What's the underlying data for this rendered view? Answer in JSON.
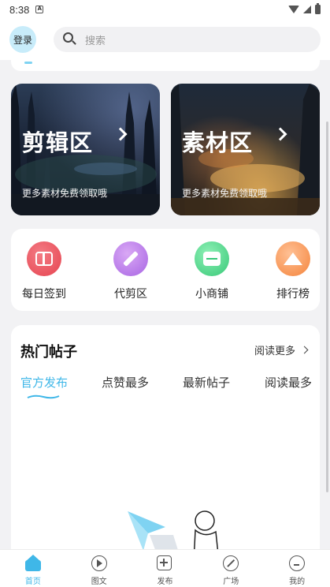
{
  "status_bar": {
    "time": "8:38",
    "notification_icon": "A"
  },
  "header": {
    "login_label": "登录",
    "search_placeholder": "搜索"
  },
  "banners": [
    {
      "title": "剪辑区",
      "subtitle": "更多素材免费领取哦"
    },
    {
      "title": "素材区",
      "subtitle": "更多素材免费领取哦"
    }
  ],
  "quick_actions": [
    {
      "label": "每日签到",
      "icon": "gift-box-icon",
      "color": "#e6434f"
    },
    {
      "label": "代剪区",
      "icon": "pencil-ruler-icon",
      "color": "#a865e3"
    },
    {
      "label": "小商铺",
      "icon": "shop-icon",
      "color": "#37c877"
    },
    {
      "label": "排行榜",
      "icon": "crown-icon",
      "color": "#f4843c"
    }
  ],
  "hot_posts": {
    "title": "热门帖子",
    "read_more": "阅读更多",
    "tabs": [
      "官方发布",
      "点赞最多",
      "最新帖子",
      "阅读最多"
    ],
    "active_tab": "官方发布"
  },
  "bottom_nav": [
    {
      "label": "首页",
      "icon": "home-icon",
      "active": true
    },
    {
      "label": "图文",
      "icon": "play-circle-icon",
      "active": false
    },
    {
      "label": "发布",
      "icon": "plus-square-icon",
      "active": false
    },
    {
      "label": "广场",
      "icon": "compass-icon",
      "active": false
    },
    {
      "label": "我的",
      "icon": "profile-icon",
      "active": false
    }
  ],
  "colors": {
    "accent": "#3fb7e8",
    "background": "#f2f2f4",
    "card": "#ffffff"
  }
}
